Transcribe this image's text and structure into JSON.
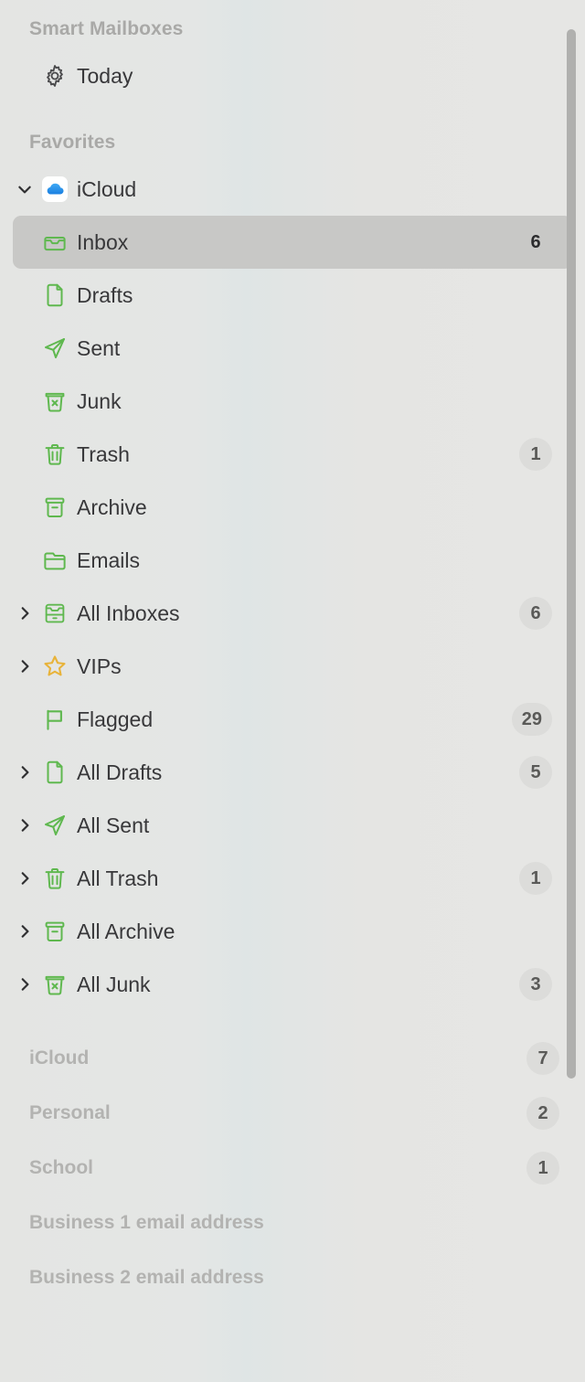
{
  "app": {
    "pane": "Mail Sidebar"
  },
  "smart_mailboxes": {
    "header": "Smart Mailboxes",
    "items": [
      {
        "label": "Today",
        "icon": "gear-icon",
        "badge": "",
        "twisty": "",
        "selected": false
      }
    ]
  },
  "favorites": {
    "header": "Favorites",
    "account": {
      "label": "iCloud",
      "icon": "icloud-cloud-icon",
      "twisty": "down",
      "badge": ""
    },
    "children": [
      {
        "label": "Inbox",
        "icon": "inbox-tray-icon",
        "badge": "6",
        "badge_plain": true,
        "selected": true
      },
      {
        "label": "Drafts",
        "icon": "document-icon",
        "badge": "",
        "badge_plain": false,
        "selected": false
      },
      {
        "label": "Sent",
        "icon": "paper-plane-icon",
        "badge": "",
        "badge_plain": false,
        "selected": false
      },
      {
        "label": "Junk",
        "icon": "junk-bin-x-icon",
        "badge": "",
        "badge_plain": false,
        "selected": false
      },
      {
        "label": "Trash",
        "icon": "trash-can-icon",
        "badge": "1",
        "badge_plain": false,
        "selected": false
      },
      {
        "label": "Archive",
        "icon": "archive-box-icon",
        "badge": "",
        "badge_plain": false,
        "selected": false
      },
      {
        "label": "Emails",
        "icon": "folder-icon",
        "badge": "",
        "badge_plain": false,
        "selected": false
      }
    ],
    "aggregates": [
      {
        "label": "All Inboxes",
        "icon": "all-inboxes-tray-icon",
        "badge": "6",
        "twisty": "right"
      },
      {
        "label": "VIPs",
        "icon": "star-icon",
        "badge": "",
        "twisty": "right"
      },
      {
        "label": "Flagged",
        "icon": "flag-icon",
        "badge": "29",
        "twisty": ""
      },
      {
        "label": "All Drafts",
        "icon": "document-icon",
        "badge": "5",
        "twisty": "right"
      },
      {
        "label": "All Sent",
        "icon": "paper-plane-icon",
        "badge": "",
        "twisty": "right"
      },
      {
        "label": "All Trash",
        "icon": "trash-can-icon",
        "badge": "1",
        "twisty": "right"
      },
      {
        "label": "All Archive",
        "icon": "archive-box-icon",
        "badge": "",
        "twisty": "right"
      },
      {
        "label": "All Junk",
        "icon": "junk-bin-x-icon",
        "badge": "3",
        "twisty": "right"
      }
    ]
  },
  "accounts": [
    {
      "label": "iCloud",
      "badge": "7"
    },
    {
      "label": "Personal",
      "badge": "2"
    },
    {
      "label": "School",
      "badge": "1"
    },
    {
      "label": "Business 1 email address",
      "badge": ""
    },
    {
      "label": "Business 2 email address",
      "badge": ""
    }
  ],
  "colors": {
    "accent_green": "#5fb84f",
    "accent_yellow": "#e8b33a",
    "selection": "#c8c8c6",
    "background": "#e6e6e4",
    "badge_bg": "#dcdcda"
  },
  "scrollbar": {
    "orientation": "vertical"
  }
}
